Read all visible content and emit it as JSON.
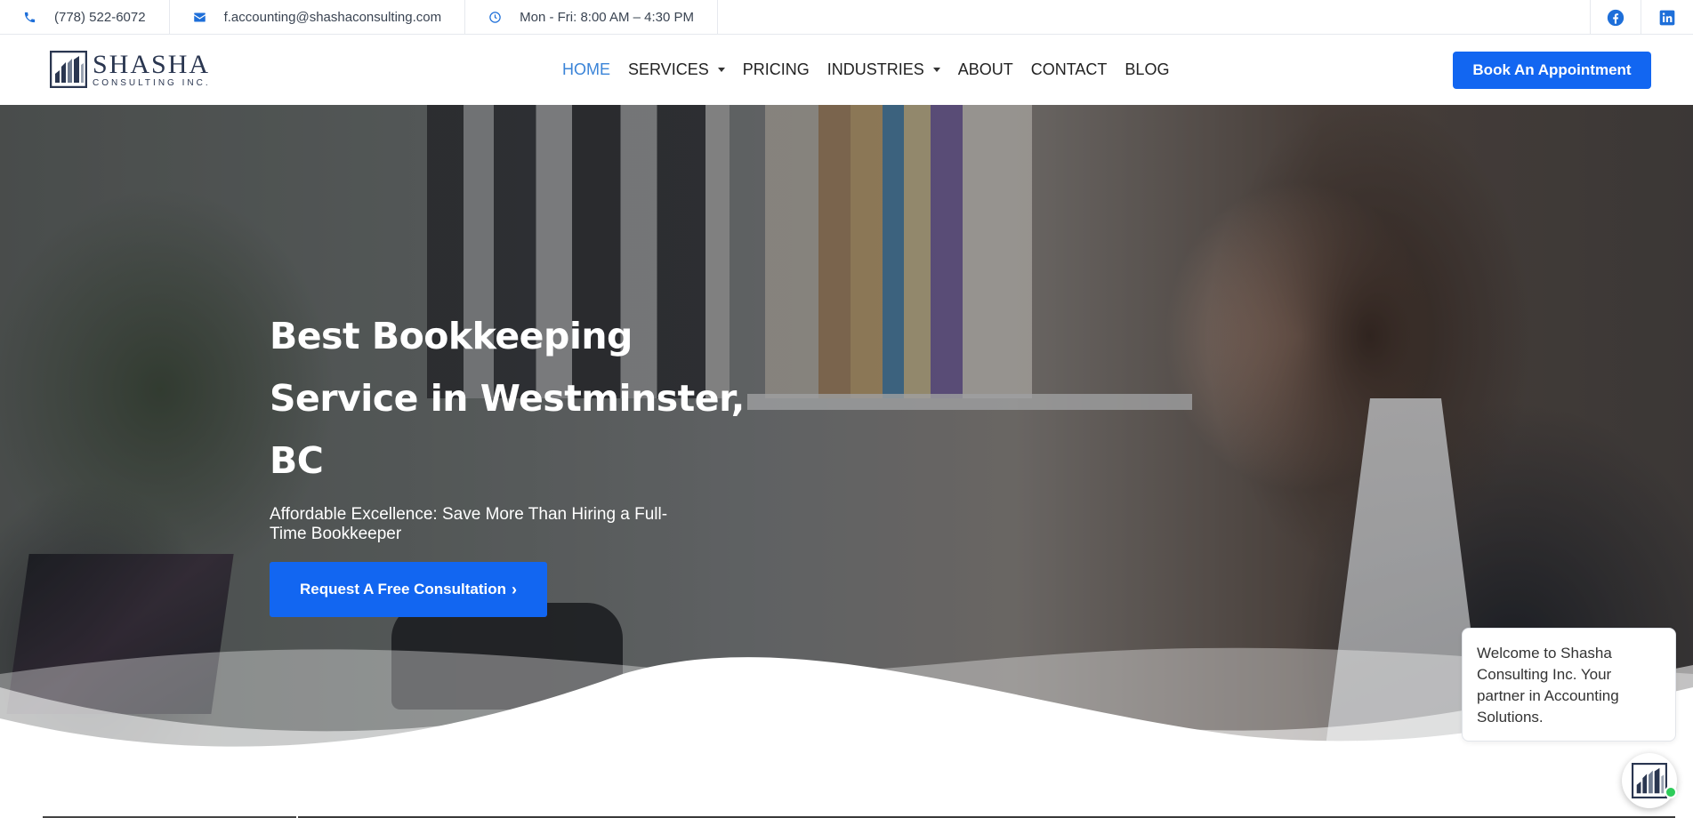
{
  "topbar": {
    "phone": "(778) 522-6072",
    "email": "f.accounting@shashaconsulting.com",
    "hours": "Mon - Fri: 8:00 AM – 4:30 PM"
  },
  "brand": {
    "name": "SHASHA",
    "sub": "CONSULTING INC."
  },
  "nav": {
    "home": "HOME",
    "services": "SERVICES",
    "pricing": "PRICING",
    "industries": "INDUSTRIES",
    "about": "ABOUT",
    "contact": "CONTACT",
    "blog": "BLOG"
  },
  "header": {
    "cta": "Book An Appointment"
  },
  "hero": {
    "title": "Best Bookkeeping Service in Westminster, BC",
    "subtitle": "Affordable Excellence: Save More Than Hiring a Full-Time Bookkeeper",
    "cta": "Request A Free Consultation"
  },
  "chat": {
    "message": "Welcome to Shasha Consulting Inc. Your partner in Accounting Solutions."
  },
  "colors": {
    "accent": "#1266f1",
    "nav_active": "#3a84d8",
    "online": "#2ecc5a"
  }
}
